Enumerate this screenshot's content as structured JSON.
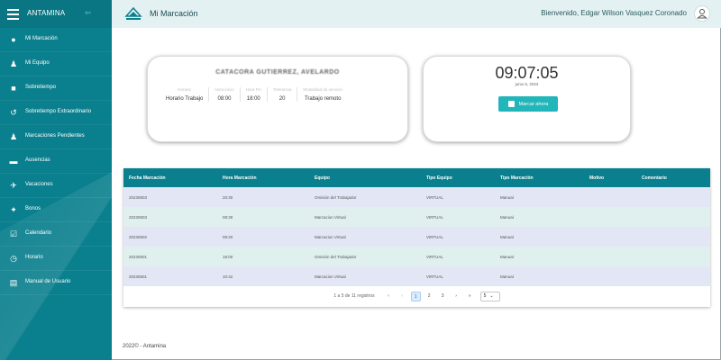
{
  "sidebar": {
    "brand": "ANTAMINA",
    "items": [
      {
        "label": "Mi Marcación",
        "icon": "fingerprint-icon",
        "glyph": "●"
      },
      {
        "label": "Mi Equipo",
        "icon": "team-icon",
        "glyph": "♟"
      },
      {
        "label": "Sobretiempo",
        "icon": "briefcase-icon",
        "glyph": "■"
      },
      {
        "label": "Sobretiempo Extraordinario",
        "icon": "history-icon",
        "glyph": "↺"
      },
      {
        "label": "Marcaciones Pendientes",
        "icon": "users-icon",
        "glyph": "♟"
      },
      {
        "label": "Ausencias",
        "icon": "calendar-minus-icon",
        "glyph": "▬"
      },
      {
        "label": "Vacaciones",
        "icon": "plane-icon",
        "glyph": "✈"
      },
      {
        "label": "Bonos",
        "icon": "gift-icon",
        "glyph": "✦"
      },
      {
        "label": "Calendario",
        "icon": "calendar-check-icon",
        "glyph": "☑"
      },
      {
        "label": "Horario",
        "icon": "clock-icon",
        "glyph": "◷"
      },
      {
        "label": "Manual de Usuario",
        "icon": "book-icon",
        "glyph": "▤"
      }
    ]
  },
  "header": {
    "title": "Mi Marcación",
    "welcome": "Bienvenido, Edgar Wilson Vasquez Coronado"
  },
  "info_card": {
    "person": "CATACORA GUTIERREZ, AVELARDO",
    "columns": [
      {
        "label": "Horario",
        "value": "Horario Trabajo"
      },
      {
        "label": "Hora inicio",
        "value": "08:00"
      },
      {
        "label": "Hora Fin",
        "value": "18:00"
      },
      {
        "label": "Tolerancia",
        "value": "20"
      },
      {
        "label": "Modalidad de servicio",
        "value": "Trabajo remoto"
      }
    ]
  },
  "clock_card": {
    "time": "09:07:05",
    "date": "junio 5, 2023",
    "button_label": "Marcar ahora"
  },
  "table": {
    "headers": [
      "Fecha Marcación",
      "Hora Marcación",
      "Equipo",
      "Tipo Equipo",
      "Tipo Marcación",
      "Motivo",
      "Comentario"
    ],
    "rows": [
      [
        "20230603",
        "20:30",
        "Omisión del Trabajador",
        "VIRTUAL",
        "Manual",
        "",
        ""
      ],
      [
        "20230603",
        "08:30",
        "Marcacion Virtual",
        "VIRTUAL",
        "Manual",
        "",
        ""
      ],
      [
        "20230602",
        "09:20",
        "Marcacion Virtual",
        "VIRTUAL",
        "Manual",
        "",
        ""
      ],
      [
        "20230601",
        "18:00",
        "Omisión del Trabajador",
        "VIRTUAL",
        "Manual",
        "",
        ""
      ],
      [
        "20230601",
        "10:42",
        "Marcacion Virtual",
        "VIRTUAL",
        "Manual",
        "",
        ""
      ]
    ],
    "pager": {
      "records": "1 a 5 de 11 registros",
      "first": "«",
      "prev": "‹",
      "pages": [
        "1",
        "2",
        "3"
      ],
      "next": "›",
      "last": "»",
      "page_size": "5"
    }
  },
  "footer": "2022© - Antamina",
  "colors": {
    "sidebar": "#0a7f8d",
    "accent": "#22b5b9",
    "header_bg": "#e3f1f2"
  }
}
